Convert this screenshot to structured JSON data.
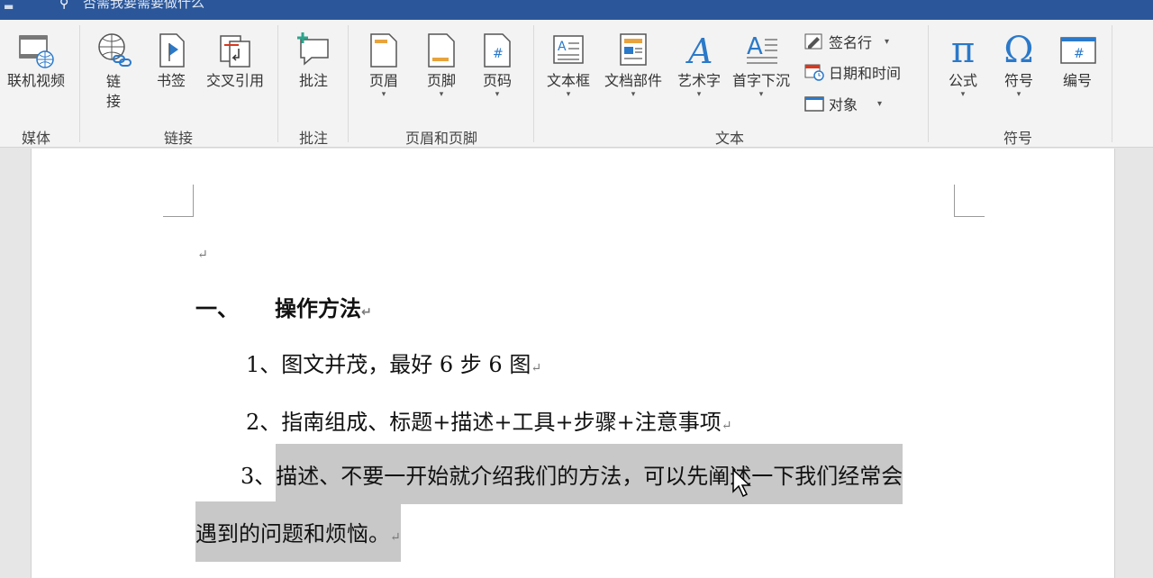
{
  "titlebar": {
    "text": "否需我要需要做什么"
  },
  "ribbon": {
    "groups": {
      "media": {
        "label": "媒体",
        "buttons": {
          "online_video": "联机视频"
        }
      },
      "links": {
        "label": "链接",
        "buttons": {
          "link": "链\n接",
          "bookmark": "书签",
          "cross_ref": "交叉引用"
        }
      },
      "comments": {
        "label": "批注",
        "buttons": {
          "comment": "批注"
        }
      },
      "header_footer": {
        "label": "页眉和页脚",
        "buttons": {
          "header": "页眉",
          "footer": "页脚",
          "page_number": "页码"
        }
      },
      "text": {
        "label": "文本",
        "buttons": {
          "textbox": "文本框",
          "doc_parts": "文档部件",
          "wordart": "艺术字",
          "dropcap": "首字下沉"
        },
        "small": {
          "signature": "签名行",
          "datetime": "日期和时间",
          "object": "对象"
        }
      },
      "symbols": {
        "label": "符号",
        "buttons": {
          "equation": "公式",
          "symbol": "符号",
          "number": "编号"
        }
      }
    }
  },
  "document": {
    "heading_num": "一、",
    "heading_text": "操作方法",
    "item1": "1、图文并茂，最好 6 步 6 图",
    "item2": "2、指南组成、标题+描述+工具+步骤+注意事项",
    "item3_num": "3、",
    "item3_line1": "描述、不要一开始就介绍我们的方法，可以先阐述一下我们经常会",
    "item3_line2": "遇到的问题和烦恼。",
    "para_mark": "↵"
  },
  "icons": {
    "pi": "π",
    "omega": "Ω",
    "wordart_a": "A"
  },
  "colors": {
    "accent": "#2b579a",
    "selection": "#c8c8c8"
  }
}
